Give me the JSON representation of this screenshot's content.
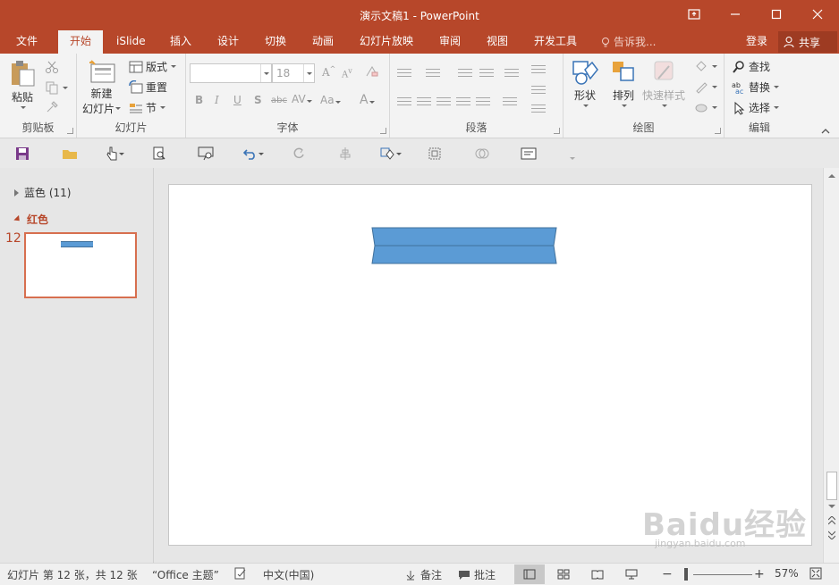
{
  "window": {
    "title": "演示文稿1 - PowerPoint"
  },
  "tabs": [
    "文件",
    "开始",
    "iSlide",
    "插入",
    "设计",
    "切换",
    "动画",
    "幻灯片放映",
    "审阅",
    "视图",
    "开发工具"
  ],
  "tell_me": "告诉我...",
  "login": "登录",
  "share": "共享",
  "ribbon": {
    "clipboard": {
      "label": "剪贴板",
      "paste": "粘贴"
    },
    "slides": {
      "label": "幻灯片",
      "new_slide_1": "新建",
      "new_slide_2": "幻灯片",
      "layout": "版式",
      "reset": "重置",
      "section": "节"
    },
    "font": {
      "label": "字体",
      "size": "18"
    },
    "paragraph": {
      "label": "段落"
    },
    "drawing": {
      "label": "绘图",
      "shapes": "形状",
      "arrange": "排列",
      "quick_styles": "快速样式"
    },
    "editing": {
      "label": "编辑",
      "find": "查找",
      "replace": "替换",
      "select": "选择"
    }
  },
  "sections": [
    {
      "name": "蓝色 (11)",
      "expanded": false
    },
    {
      "name": "红色",
      "expanded": true
    }
  ],
  "slide_number": "12",
  "status": {
    "slide_info": "幻灯片 第 12 张，共 12 张",
    "theme": "“Office 主题”",
    "language": "中文(中国)",
    "notes": "备注",
    "comments": "批注",
    "zoom": "57%"
  },
  "watermark": {
    "brand": "Baidu经验",
    "url": "jingyan.baidu.com"
  },
  "colors": {
    "accent": "#b7472a",
    "shape_fill": "#5b9bd5",
    "shape_stroke": "#41719c"
  }
}
